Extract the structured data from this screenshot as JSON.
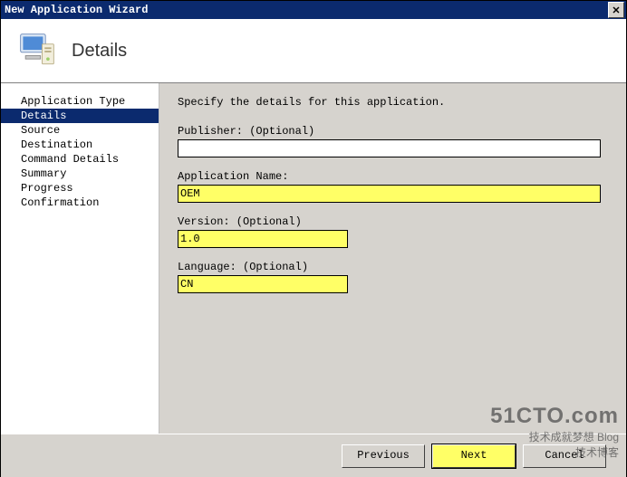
{
  "window": {
    "title": "New Application Wizard"
  },
  "header": {
    "title": "Details"
  },
  "sidebar": {
    "items": [
      {
        "label": "Application Type"
      },
      {
        "label": "Details"
      },
      {
        "label": "Source"
      },
      {
        "label": "Destination"
      },
      {
        "label": "Command Details"
      },
      {
        "label": "Summary"
      },
      {
        "label": "Progress"
      },
      {
        "label": "Confirmation"
      }
    ],
    "selected_index": 1
  },
  "main": {
    "instruction": "Specify the details for this application.",
    "fields": {
      "publisher": {
        "label": "Publisher: (Optional)",
        "value": ""
      },
      "application_name": {
        "label": "Application Name:",
        "value": "OEM"
      },
      "version": {
        "label": "Version: (Optional)",
        "value": "1.0"
      },
      "language": {
        "label": "Language: (Optional)",
        "value": "CN"
      }
    }
  },
  "footer": {
    "previous": "Previous",
    "next": "Next",
    "cancel": "Cancel"
  },
  "watermark": {
    "line1": "51CTO.com",
    "line2": "技术成就梦想 Blog",
    "line3": "技术博客"
  }
}
